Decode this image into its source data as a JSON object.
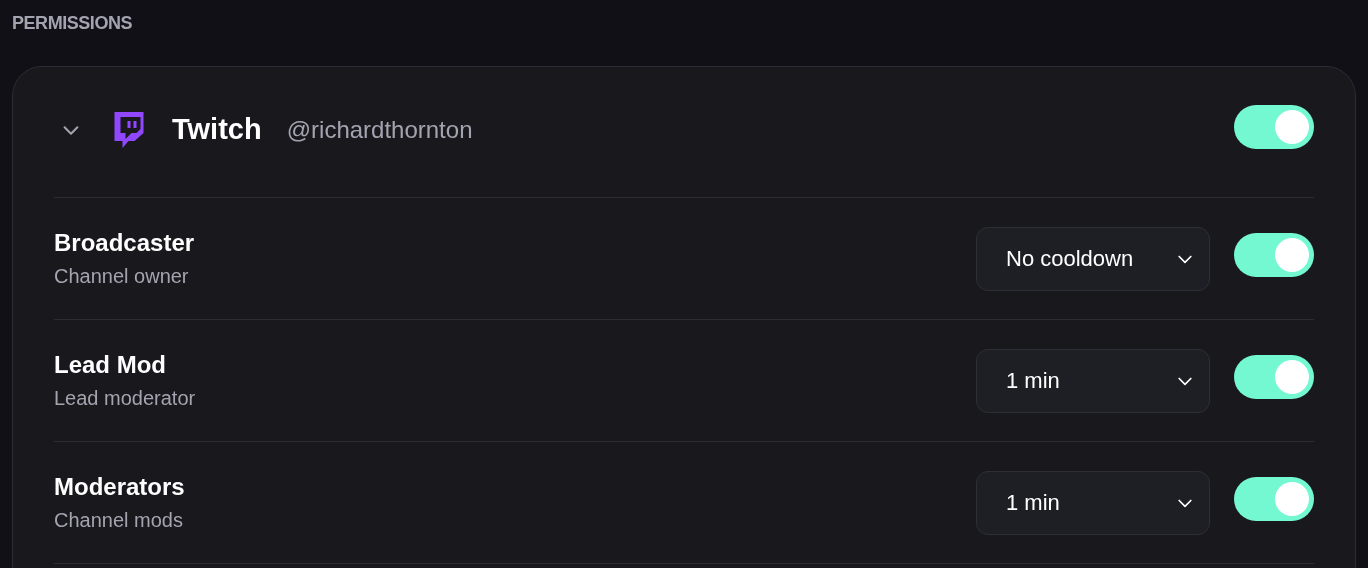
{
  "section_title": "PERMISSIONS",
  "platform": {
    "name": "Twitch",
    "handle": "@richardthornton",
    "expanded": true,
    "on": true
  },
  "roles": [
    {
      "name": "Broadcaster",
      "description": "Channel owner",
      "cooldown": "No cooldown",
      "on": true
    },
    {
      "name": "Lead Mod",
      "description": "Lead moderator",
      "cooldown": "1 min",
      "on": true
    },
    {
      "name": "Moderators",
      "description": "Channel mods",
      "cooldown": "1 min",
      "on": true
    }
  ]
}
